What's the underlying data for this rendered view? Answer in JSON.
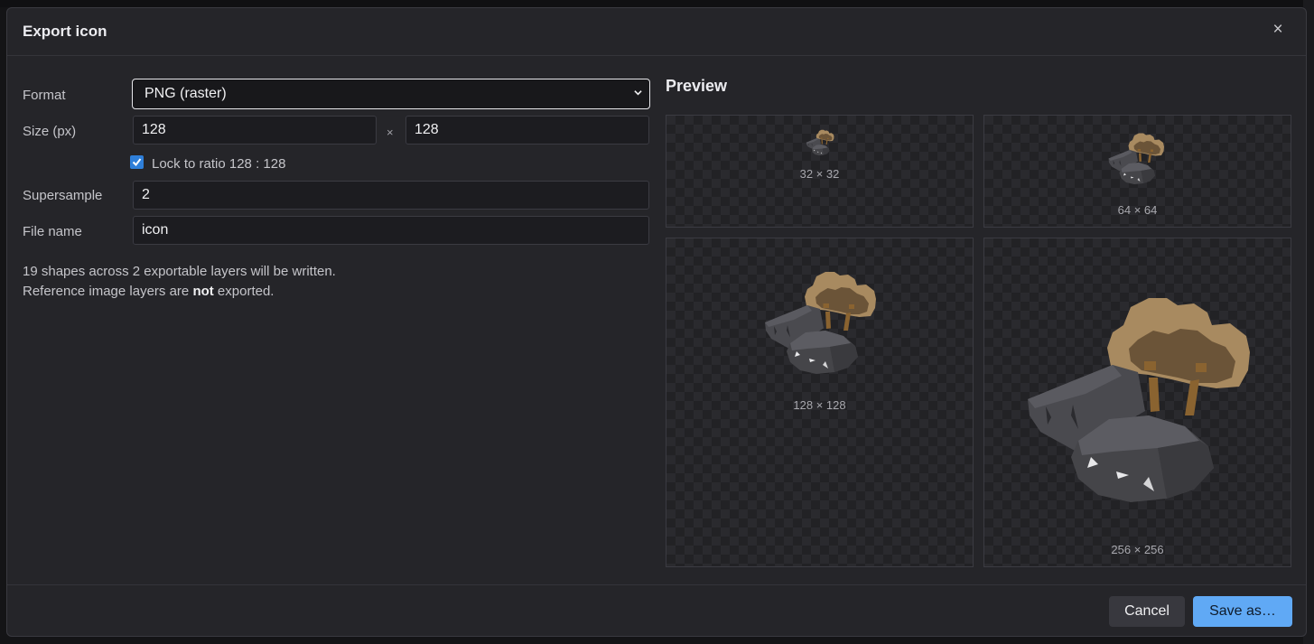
{
  "dialog": {
    "title": "Export icon",
    "close_label": "×"
  },
  "form": {
    "format_label": "Format",
    "format_value": "PNG (raster)",
    "size_label": "Size (px)",
    "width": "128",
    "times": "×",
    "height": "128",
    "lock_label": "Lock to ratio 128 : 128",
    "lock_checked": true,
    "supersample_label": "Supersample",
    "supersample_value": "2",
    "filename_label": "File name",
    "filename_value": "icon"
  },
  "info": {
    "line1": "19 shapes across 2 exportable layers will be written.",
    "line2_pre": "Reference image layers are ",
    "line2_bold": "not",
    "line2_post": " exported."
  },
  "preview": {
    "title": "Preview",
    "sizes": [
      "32 × 32",
      "64 × 64",
      "128 × 128",
      "256 × 256"
    ]
  },
  "footer": {
    "cancel_label": "Cancel",
    "save_label": "Save as…"
  },
  "colors": {
    "accent": "#60a9f5",
    "checkbox": "#2f7fd9",
    "rock": "#4a4a4f",
    "tree_light": "#a88a60",
    "tree_dark": "#6b5438",
    "trunk": "#8a6330"
  }
}
